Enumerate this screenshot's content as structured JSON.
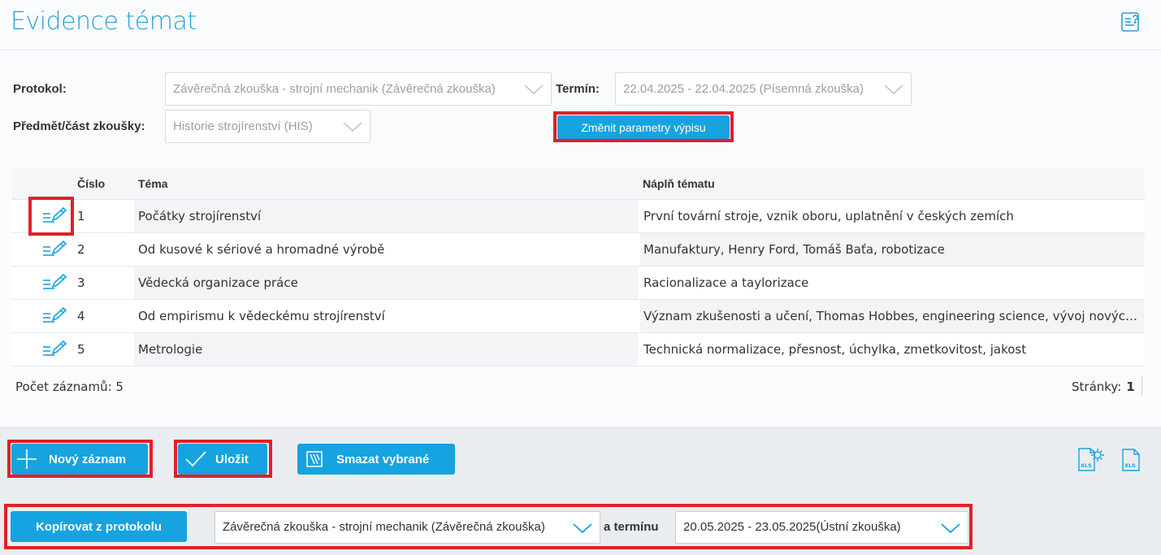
{
  "header": {
    "title": "Evidence témat",
    "help_icon": "help-list-icon"
  },
  "filters": {
    "protokol_label": "Protokol:",
    "protokol_value": "Závěrečná zkouška - strojní mechanik (Závěrečná zkouška)",
    "termin_label": "Termín:",
    "termin_value": "22.04.2025 - 22.04.2025 (Písemná zkouška)",
    "predmet_label": "Předmět/část zkoušky:",
    "predmet_value": "Historie strojírenství (HIS)",
    "change_button": "Změnit parametry výpisu"
  },
  "table": {
    "columns": [
      "Číslo",
      "Téma",
      "Náplň tématu"
    ],
    "rows": [
      {
        "cislo": "1",
        "tema": "Počátky strojírenství",
        "napln": "První tovární stroje, vznik oboru, uplatnění v českých zemích"
      },
      {
        "cislo": "2",
        "tema": "Od kusové k sériové a hromadné výrobě",
        "napln": "Manufaktury, Henry Ford, Tomáš Baťa, robotizace"
      },
      {
        "cislo": "3",
        "tema": "Vědecká organizace práce",
        "napln": "Racionalizace a taylorizace"
      },
      {
        "cislo": "4",
        "tema": "Od empirismu k vědeckému strojírenství",
        "napln": "Význam zkušenosti a učení, Thomas Hobbes, engineering science, vývoj nových te..."
      },
      {
        "cislo": "5",
        "tema": "Metrologie",
        "napln": "Technická normalizace, přesnost, úchylka, zmetkovitost, jakost"
      }
    ]
  },
  "footer": {
    "count": "Počet záznamů: 5",
    "pages_label": "Stránky:",
    "current_page": "1"
  },
  "actions": {
    "new_record": "Nový záznam",
    "save": "Uložit",
    "delete_selected": "Smazat vybrané",
    "copy_from_protocol": "Kopírovat z protokolu",
    "copy_protocol_value": "Závěrečná zkouška - strojní mechanik (Závěrečná zkouška)",
    "and_term_label": "a termínu",
    "copy_term_value": "20.05.2025 - 23.05.2025(Ústní zkouška)"
  },
  "colors": {
    "accent": "#16a3e0",
    "title": "#2a9fd8",
    "highlight": "#e0202a"
  }
}
